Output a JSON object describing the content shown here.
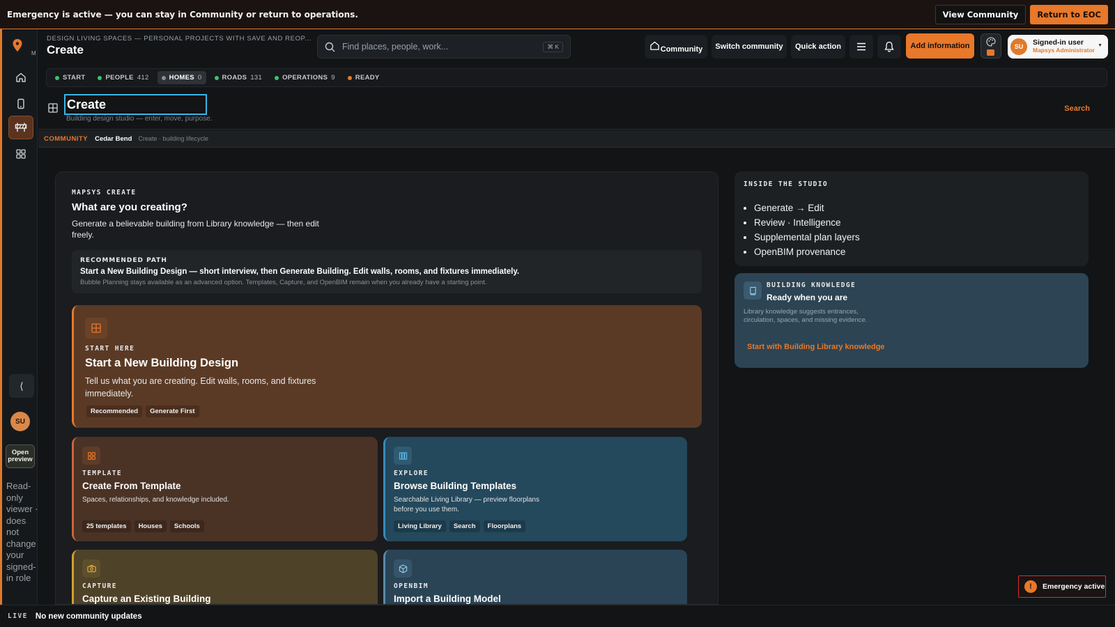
{
  "banner": {
    "message": "Emergency is active — you can stay in Community or return to operations.",
    "view_community": "View Community",
    "return_to_eoc": "Return to EOC"
  },
  "rail": {
    "mini_label": "M",
    "collapse_glyph": "⟨",
    "avatar": "SU",
    "open_preview": "Open preview",
    "readonly_note": "Read-only viewer · does not change your signed-in role",
    "icons": [
      "map-pin-icon",
      "home-icon",
      "tablet-icon",
      "barrier-icon",
      "grid-icon"
    ]
  },
  "header": {
    "crumb": "DESIGN LIVING SPACES — PERSONAL PROJECTS WITH SAVE AND REOP...",
    "title": "Create",
    "search_placeholder": "Find places, people, work...",
    "search_kbd": "⌘ K",
    "community": "Community",
    "switch_community": "Switch community",
    "quick_action": "Quick action",
    "add_information": "Add information",
    "user_initials": "SU",
    "user_name": "Signed-in user",
    "user_role": "Mapsys Administrator"
  },
  "status": [
    {
      "label": "START",
      "count": "",
      "color": "#3ac46a",
      "active": false
    },
    {
      "label": "PEOPLE",
      "count": "412",
      "color": "#3ac46a",
      "active": false
    },
    {
      "label": "HOMES",
      "count": "0",
      "color": "#8a9096",
      "active": true
    },
    {
      "label": "ROADS",
      "count": "131",
      "color": "#3ac46a",
      "active": false
    },
    {
      "label": "OPERATIONS",
      "count": "9",
      "color": "#3ac46a",
      "active": false
    },
    {
      "label": "READY",
      "count": "",
      "color": "#e8782a",
      "active": false
    }
  ],
  "titlebar": {
    "value": "Create",
    "subtitle": "Building design studio — enter, move, purpose.",
    "search": "Search"
  },
  "breadcrumb": {
    "community": "COMMUNITY",
    "name": "Cedar Bend",
    "lifecycle": "Create · building lifecycle"
  },
  "main": {
    "eyebrow": "MAPSYS CREATE",
    "heading": "What are you creating?",
    "intro": "Generate a believable building from Library knowledge — then edit freely.",
    "recommended": {
      "eyebrow": "RECOMMENDED PATH",
      "text": "Start a New Building Design — short interview, then Generate Building. Edit walls, rooms, and fixtures immediately.",
      "sub": "Bubble Planning stays available as an advanced option. Templates, Capture, and OpenBIM remain when you already have a starting point."
    },
    "start": {
      "eyebrow": "START HERE",
      "heading": "Start a New Building Design",
      "text": "Tell us what you are creating. Edit walls, rooms, and fixtures immediately.",
      "tags": [
        "Recommended",
        "Generate First"
      ]
    },
    "template": {
      "eyebrow": "TEMPLATE",
      "heading": "Create From Template",
      "text": "Spaces, relationships, and knowledge included.",
      "tags": [
        "25 templates",
        "Houses",
        "Schools"
      ]
    },
    "explore": {
      "eyebrow": "EXPLORE",
      "heading": "Browse Building Templates",
      "text": "Searchable Living Library — preview floorplans before you use them.",
      "tags": [
        "Living Library",
        "Search",
        "Floorplans"
      ]
    },
    "capture": {
      "eyebrow": "CAPTURE",
      "heading": "Capture an Existing Building"
    },
    "openbim": {
      "eyebrow": "OPENBIM",
      "heading": "Import a Building Model"
    }
  },
  "inside": {
    "eyebrow": "INSIDE THE STUDIO",
    "items": [
      "Generate → Edit",
      "Review · Intelligence",
      "Supplemental plan layers",
      "OpenBIM provenance"
    ]
  },
  "knowledge": {
    "eyebrow": "BUILDING KNOWLEDGE",
    "heading": "Ready when you are",
    "text": "Library knowledge suggests entrances, circulation, spaces, and missing evidence.",
    "link": "Start with Building Library knowledge"
  },
  "emergency_chip": {
    "glyph": "!",
    "label": "Emergency active"
  },
  "footer": {
    "live": "LIVE",
    "text": "No new community updates"
  }
}
